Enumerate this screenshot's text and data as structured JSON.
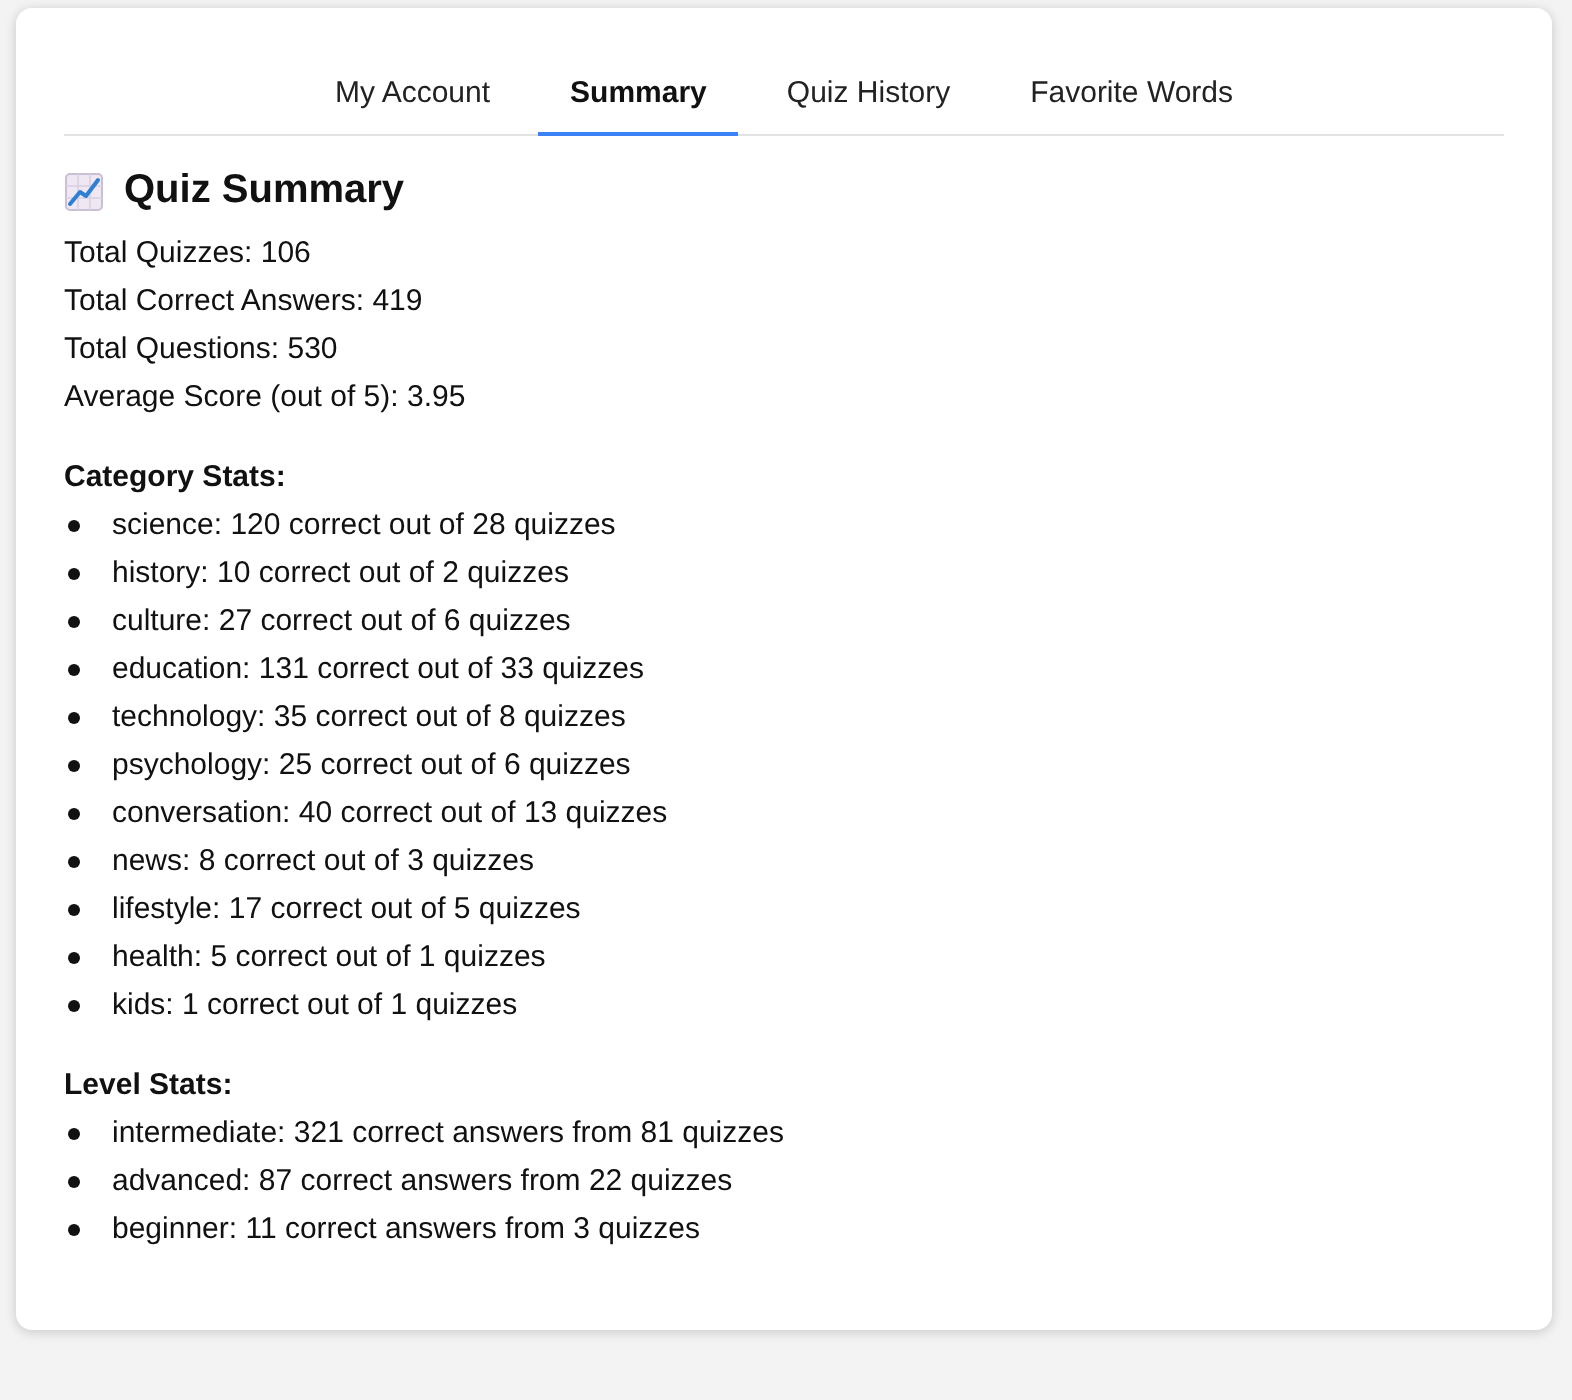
{
  "tabs": [
    {
      "label": "My Account",
      "selected": false
    },
    {
      "label": "Summary",
      "selected": true
    },
    {
      "label": "Quiz History",
      "selected": false
    },
    {
      "label": "Favorite Words",
      "selected": false
    }
  ],
  "summary": {
    "title": "Quiz Summary",
    "totals": [
      "Total Quizzes: 106",
      "Total Correct Answers: 419",
      "Total Questions: 530",
      "Average Score (out of 5): 3.95"
    ],
    "sections": [
      {
        "heading": "Category Stats:",
        "items": [
          "science: 120 correct out of 28 quizzes",
          "history: 10 correct out of 2 quizzes",
          "culture: 27 correct out of 6 quizzes",
          "education: 131 correct out of 33 quizzes",
          "technology: 35 correct out of 8 quizzes",
          "psychology: 25 correct out of 6 quizzes",
          "conversation: 40 correct out of 13 quizzes",
          "news: 8 correct out of 3 quizzes",
          "lifestyle: 17 correct out of 5 quizzes",
          "health: 5 correct out of 1 quizzes",
          "kids: 1 correct out of 1 quizzes"
        ]
      },
      {
        "heading": "Level Stats:",
        "items": [
          "intermediate: 321 correct answers from 81 quizzes",
          "advanced: 87 correct answers from 22 quizzes",
          "beginner: 11 correct answers from 3 quizzes"
        ]
      }
    ]
  }
}
